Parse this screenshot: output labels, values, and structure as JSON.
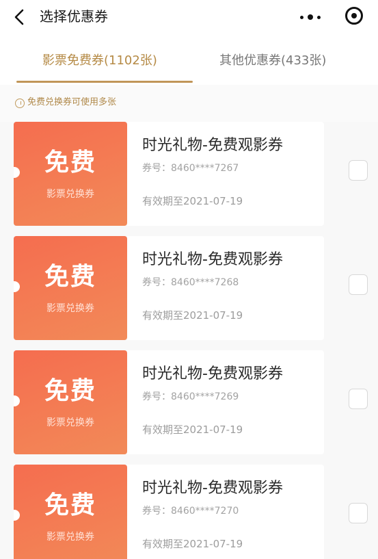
{
  "nav": {
    "title": "选择优惠券",
    "back_icon": "chevron-left-icon",
    "more_icon": "more-dots-icon",
    "target_icon": "target-circle-icon"
  },
  "tabs": [
    {
      "label": "影票免费券(1102张)",
      "active": true
    },
    {
      "label": "其他优惠券(433张)",
      "active": false
    }
  ],
  "tip": {
    "text": "免费兑换券可使用多张",
    "icon": "bulb-icon"
  },
  "coupons": [
    {
      "stub_title": "免费",
      "stub_subtitle": "影票兑换券",
      "name": "时光礼物-免费观影券",
      "code": "券号：8460****7267",
      "validity": "有效期至2021-07-19",
      "checked": false
    },
    {
      "stub_title": "免费",
      "stub_subtitle": "影票兑换券",
      "name": "时光礼物-免费观影券",
      "code": "券号：8460****7268",
      "validity": "有效期至2021-07-19",
      "checked": false
    },
    {
      "stub_title": "免费",
      "stub_subtitle": "影票兑换券",
      "name": "时光礼物-免费观影券",
      "code": "券号：8460****7269",
      "validity": "有效期至2021-07-19",
      "checked": false
    },
    {
      "stub_title": "免费",
      "stub_subtitle": "影票兑换券",
      "name": "时光礼物-免费观影券",
      "code": "券号：8460****7270",
      "validity": "有效期至2021-07-19",
      "checked": false
    }
  ],
  "colors": {
    "accent_gold": "#b58a45",
    "stub_gradient_start": "#f56d4f",
    "stub_gradient_end": "#f28a58"
  }
}
